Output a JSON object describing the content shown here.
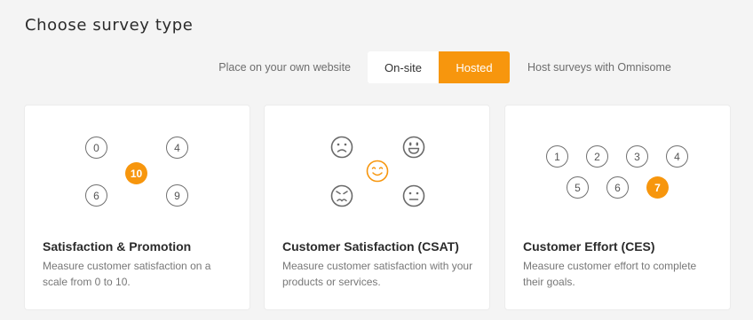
{
  "page": {
    "title": "Choose survey type"
  },
  "toggle": {
    "left_label": "Place on your own website",
    "options": [
      "On-site",
      "Hosted"
    ],
    "selected": "Hosted",
    "right_label": "Host surveys with Omnisome",
    "accent_color": "#f7960d"
  },
  "cards": [
    {
      "title": "Satisfaction & Promotion",
      "description": "Measure customer satisfaction on a scale from 0 to 10.",
      "scale": [
        "0",
        "4",
        "10",
        "6",
        "9"
      ],
      "selected": "10"
    },
    {
      "title": "Customer Satisfaction (CSAT)",
      "description": "Measure customer satisfaction with your products or services.",
      "faces": [
        "sad-face-icon",
        "happy-face-icon",
        "smile-face-icon",
        "angry-face-icon",
        "neutral-face-icon"
      ],
      "selected": "smile-face-icon"
    },
    {
      "title": "Customer Effort (CES)",
      "description": "Measure customer effort to complete their goals.",
      "scale": [
        "1",
        "2",
        "3",
        "4",
        "5",
        "6",
        "7"
      ],
      "selected": "7"
    }
  ]
}
